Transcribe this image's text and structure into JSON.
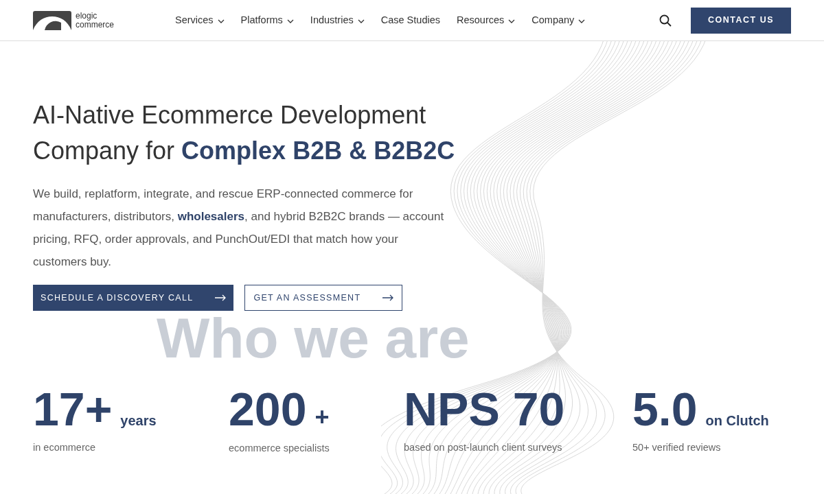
{
  "header": {
    "logo_text": [
      "elogic",
      "commerce"
    ],
    "nav": [
      {
        "label": "Services",
        "dropdown": true
      },
      {
        "label": "Platforms",
        "dropdown": true
      },
      {
        "label": "Industries",
        "dropdown": true
      },
      {
        "label": "Case Studies",
        "dropdown": false
      },
      {
        "label": "Resources",
        "dropdown": true
      },
      {
        "label": "Company",
        "dropdown": true
      }
    ],
    "cta": "CONTACT US"
  },
  "hero": {
    "title_lines": [
      "AI-Native Ecommerce Development",
      "Company for **Complex B2B & B2B2C**"
    ],
    "description": "We build, replatform, integrate, and rescue ERP-connected commerce for manufacturers, distributors, **wholesalers**, and hybrid B2B2C brands — account pricing, RFQ, order approvals, and PunchOut/EDI that match how your customers buy.",
    "buttons": [
      {
        "label": "SCHEDULE A DISCOVERY CALL",
        "kind": "primary"
      },
      {
        "label": "GET AN ASSESSMENT",
        "kind": "outline"
      }
    ]
  },
  "section_heading": "Who we are",
  "stats": [
    {
      "value": "17+",
      "unit": "years",
      "caption": "in ecommerce"
    },
    {
      "value": "200",
      "unit": "+",
      "caption": "ecommerce specialists"
    },
    {
      "value": "NPS 70",
      "caption": "based on post-launch client surveys"
    },
    {
      "value": "5.0",
      "unit": "on Clutch",
      "caption": "50+ verified reviews"
    }
  ]
}
